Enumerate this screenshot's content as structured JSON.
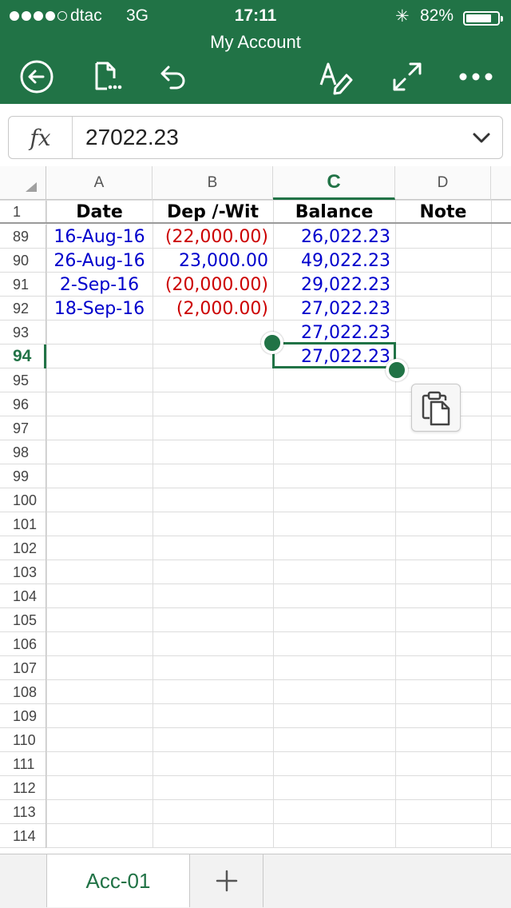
{
  "status_bar": {
    "signal_filled": 4,
    "signal_total": 5,
    "carrier": "dtac",
    "network": "3G",
    "time": "17:11",
    "bluetooth": "✳",
    "battery_percent": "82%",
    "battery_level": 0.82
  },
  "app": {
    "title": "My Account",
    "accent": "#217346"
  },
  "toolbar": {
    "icons": [
      "back-icon",
      "file-icon",
      "undo-icon",
      "format-icon",
      "fullscreen-icon",
      "more-icon"
    ]
  },
  "formula_bar": {
    "label": "fx",
    "value": "27022.23"
  },
  "columns": [
    {
      "label": "A",
      "active": false
    },
    {
      "label": "B",
      "active": false
    },
    {
      "label": "C",
      "active": true
    },
    {
      "label": "D",
      "active": false
    }
  ],
  "header_row": {
    "row": "1",
    "date": "Date",
    "dep_wit": "Dep /-Wit",
    "balance": "Balance",
    "note": "Note"
  },
  "rows": [
    {
      "row": "89",
      "date": "16-Aug-16",
      "amount": "(22,000.00)",
      "amount_type": "red",
      "balance": "26,022.23"
    },
    {
      "row": "90",
      "date": "26-Aug-16",
      "amount": "23,000.00",
      "amount_type": "blue",
      "balance": "49,022.23"
    },
    {
      "row": "91",
      "date": "2-Sep-16",
      "amount": "(20,000.00)",
      "amount_type": "red",
      "balance": "29,022.23"
    },
    {
      "row": "92",
      "date": "18-Sep-16",
      "amount": "(2,000.00)",
      "amount_type": "red",
      "balance": "27,022.23"
    },
    {
      "row": "93",
      "date": "",
      "amount": "",
      "amount_type": "blue",
      "balance": "27,022.23"
    },
    {
      "row": "94",
      "date": "",
      "amount": "",
      "amount_type": "blue",
      "balance": "27,022.23",
      "active": true
    }
  ],
  "empty_rows": [
    "95",
    "96",
    "97",
    "98",
    "99",
    "100",
    "101",
    "102",
    "103",
    "104",
    "105",
    "106",
    "107",
    "108",
    "109",
    "110",
    "111",
    "112",
    "113",
    "114"
  ],
  "sheet_tabs": {
    "active": "Acc-01",
    "add": "+"
  }
}
